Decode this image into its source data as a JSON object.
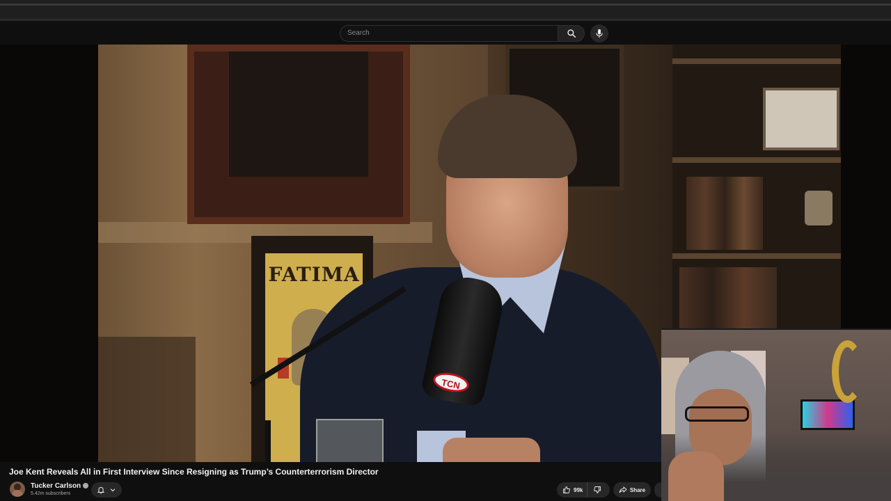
{
  "search": {
    "placeholder": "Search"
  },
  "icons": {
    "search": "search-icon",
    "mic": "microphone-icon",
    "bell": "bell-icon",
    "chevron": "chevron-down-icon",
    "like": "thumbs-up-icon",
    "dislike": "thumbs-down-icon",
    "share": "share-icon",
    "verified": "verified-badge-icon"
  },
  "video": {
    "title": "Joe Kent Reveals All in First Interview Since Resigning as Trump’s Counterterrorism Director",
    "sign_text": "FATIMA",
    "mic_brand": "TCN"
  },
  "channel": {
    "name": "Tucker Carlson",
    "subscribers": "5.42m subscribers"
  },
  "actions": {
    "likes": "99k",
    "share_label": "Share"
  },
  "colors": {
    "background": "#0f0f0f",
    "button": "#272727",
    "text": "#f1f1f1",
    "muted": "#aaaaaa"
  }
}
